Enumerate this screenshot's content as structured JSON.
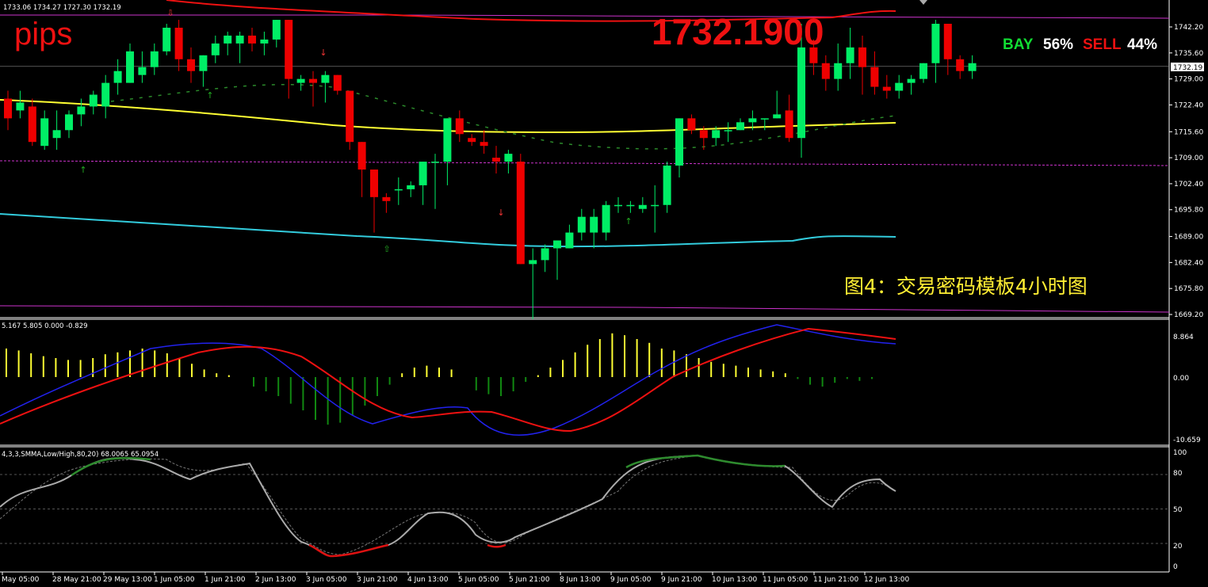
{
  "header": {
    "ohlc": "1733.06 1734.27 1727.30 1732.19",
    "pips": "pips",
    "big_price": "1732.1900",
    "bay_label": "BAY",
    "bay_pct": "56%",
    "sell_label": "SELL",
    "sell_pct": "44%",
    "caption": "图4：交易密码模板4小时图"
  },
  "colors": {
    "background": "#000000",
    "bull": "#00ee66",
    "bear": "#ee0000",
    "ma_yellow": "#ffff33",
    "band_cyan": "#33ccdd",
    "band_red": "#ee1111",
    "level_magenta": "#cc33cc",
    "hist_pos": "#ffff33",
    "hist_neg": "#118811",
    "osc_fast": "#2222ee",
    "osc_slow": "#ee1111",
    "stoch_main": "#aaaaaa",
    "stoch_ob": "#2e8b2e",
    "stoch_os": "#dd1111"
  },
  "chart_data": {
    "type": "candlestick",
    "price_axis_ticks": [
      "1742.20",
      "1735.60",
      "1729.00",
      "1722.40",
      "1715.60",
      "1709.00",
      "1702.40",
      "1695.80",
      "1689.00",
      "1682.40",
      "1675.80",
      "1669.20"
    ],
    "current_price_tag": "1732.19",
    "oscillator_ticks": [
      "8.864",
      "0.00",
      "-10.659"
    ],
    "oscillator_label": "5.167 5.805 0.000 -0.829",
    "stochastic_label": "4,3,3,SMMA,Low/High,80,20) 68.0065 65.0954",
    "stochastic_ticks": [
      "100",
      "80",
      "50",
      "20",
      "0"
    ],
    "time_labels": [
      "May 05:00",
      "28 May 21:00",
      "29 May 13:00",
      "1 Jun 05:00",
      "1 Jun 21:00",
      "2 Jun 13:00",
      "3 Jun 05:00",
      "3 Jun 21:00",
      "4 Jun 13:00",
      "5 Jun 05:00",
      "5 Jun 21:00",
      "8 Jun 13:00",
      "9 Jun 05:00",
      "9 Jun 21:00",
      "10 Jun 13:00",
      "11 Jun 05:00",
      "11 Jun 21:00",
      "12 Jun 13:00"
    ],
    "candles": [
      [
        1724,
        1726,
        1716,
        1719
      ],
      [
        1721,
        1726,
        1719,
        1723
      ],
      [
        1722,
        1724,
        1712,
        1713
      ],
      [
        1712,
        1721,
        1711,
        1719
      ],
      [
        1714,
        1721,
        1711,
        1716
      ],
      [
        1716,
        1721,
        1714,
        1720
      ],
      [
        1720,
        1724,
        1717,
        1722
      ],
      [
        1722,
        1726,
        1720,
        1725
      ],
      [
        1722,
        1730,
        1719,
        1728
      ],
      [
        1728,
        1734,
        1725,
        1731
      ],
      [
        1728,
        1738,
        1728,
        1736
      ],
      [
        1730,
        1736,
        1728,
        1732
      ],
      [
        1732,
        1738,
        1730,
        1736
      ],
      [
        1736,
        1743,
        1735,
        1742
      ],
      [
        1742,
        1744,
        1731,
        1734
      ],
      [
        1734,
        1737,
        1728,
        1731
      ],
      [
        1731,
        1735,
        1727,
        1735
      ],
      [
        1735,
        1740,
        1733,
        1738
      ],
      [
        1738,
        1741,
        1735,
        1740
      ],
      [
        1738,
        1741,
        1733,
        1740
      ],
      [
        1740,
        1742,
        1736,
        1738
      ],
      [
        1738,
        1741,
        1735,
        1739
      ],
      [
        1739,
        1744,
        1737,
        1744
      ],
      [
        1744,
        1744,
        1724,
        1729
      ],
      [
        1728,
        1730,
        1726,
        1729
      ],
      [
        1729,
        1731,
        1722,
        1728
      ],
      [
        1728,
        1731,
        1723,
        1730
      ],
      [
        1730,
        1730,
        1725,
        1726
      ],
      [
        1726,
        1726,
        1711,
        1713
      ],
      [
        1713,
        1713,
        1699,
        1706
      ],
      [
        1706,
        1706,
        1690,
        1699
      ],
      [
        1699,
        1700,
        1695,
        1698
      ],
      [
        1701,
        1704,
        1697,
        1701
      ],
      [
        1701,
        1703,
        1699,
        1702
      ],
      [
        1702,
        1708,
        1697,
        1708
      ],
      [
        1708,
        1710,
        1696,
        1708
      ],
      [
        1708,
        1719,
        1702,
        1719
      ],
      [
        1719,
        1721,
        1713,
        1715
      ],
      [
        1714,
        1715,
        1712,
        1713
      ],
      [
        1713,
        1716,
        1710,
        1712
      ],
      [
        1709,
        1712,
        1705,
        1708
      ],
      [
        1708,
        1711,
        1705,
        1710
      ],
      [
        1708,
        1710,
        1682,
        1682
      ],
      [
        1682,
        1686,
        1668,
        1683
      ],
      [
        1683,
        1687,
        1680,
        1686
      ],
      [
        1686,
        1688,
        1678,
        1688
      ],
      [
        1686,
        1692,
        1686,
        1690
      ],
      [
        1690,
        1696,
        1688,
        1694
      ],
      [
        1690,
        1696,
        1686,
        1694
      ],
      [
        1690,
        1698,
        1688,
        1697
      ],
      [
        1697,
        1699,
        1695,
        1697
      ],
      [
        1697,
        1698,
        1695,
        1697
      ],
      [
        1696,
        1699,
        1695,
        1697
      ],
      [
        1697,
        1702,
        1690,
        1697
      ],
      [
        1697,
        1708,
        1695,
        1707
      ],
      [
        1707,
        1719,
        1704,
        1719
      ],
      [
        1719,
        1720,
        1715,
        1716
      ],
      [
        1716,
        1717,
        1711,
        1714
      ],
      [
        1714,
        1717,
        1712,
        1716
      ],
      [
        1716,
        1718,
        1713,
        1716
      ],
      [
        1716,
        1719,
        1716,
        1718
      ],
      [
        1718,
        1721,
        1716,
        1719
      ],
      [
        1719,
        1719,
        1716,
        1719
      ],
      [
        1719,
        1726,
        1719,
        1720
      ],
      [
        1721,
        1725,
        1713,
        1714
      ],
      [
        1714,
        1743,
        1709,
        1737
      ],
      [
        1737,
        1739,
        1730,
        1733
      ],
      [
        1733,
        1735,
        1726,
        1729
      ],
      [
        1729,
        1738,
        1726,
        1733
      ],
      [
        1733,
        1742,
        1729,
        1737
      ],
      [
        1737,
        1740,
        1725,
        1732
      ],
      [
        1732,
        1736,
        1725,
        1727
      ],
      [
        1727,
        1730,
        1724,
        1726
      ],
      [
        1726,
        1730,
        1724,
        1728
      ],
      [
        1728,
        1730,
        1725,
        1729
      ],
      [
        1729,
        1733,
        1728,
        1733
      ],
      [
        1733,
        1744,
        1728,
        1743
      ],
      [
        1743,
        1743,
        1730,
        1734
      ],
      [
        1734,
        1735,
        1729,
        1731
      ],
      [
        1731,
        1735,
        1729,
        1733
      ]
    ]
  }
}
